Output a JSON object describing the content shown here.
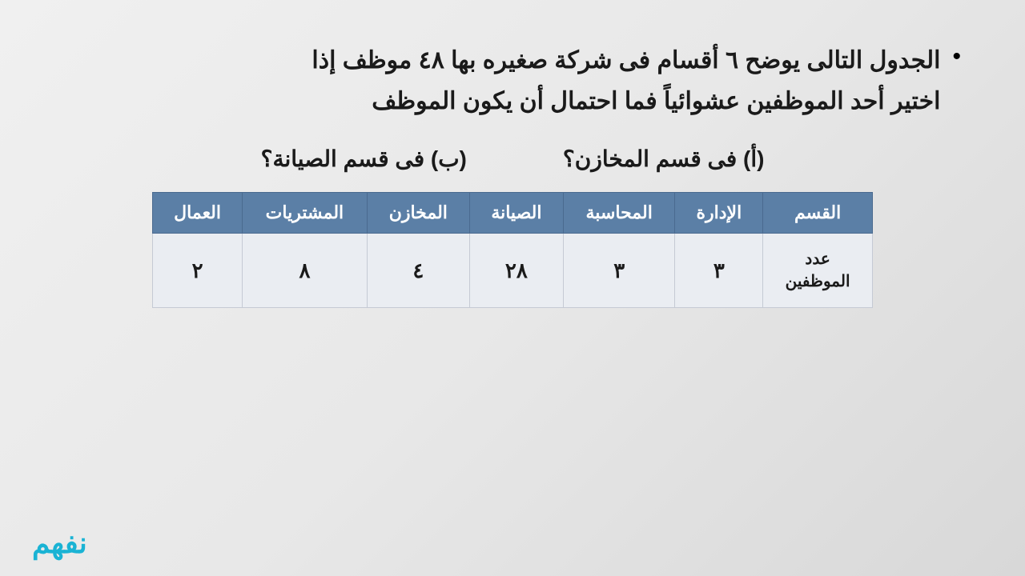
{
  "question": {
    "main_text_line1": "الجدول التالى يوضح ٦ أقسام فى شركة صغيره بها ٤٨ موظف إذا",
    "main_text_line2": "اختير أحد الموظفين عشوائياً فما احتمال أن يكون الموظف",
    "part_a": "(أ) فى قسم المخازن؟",
    "part_b": "(ب) فى قسم الصيانة؟"
  },
  "table": {
    "headers": [
      "القسم",
      "الإدارة",
      "المحاسبة",
      "الصيانة",
      "المخازن",
      "المشتريات",
      "العمال"
    ],
    "row_label": "عدد الموظفين",
    "values": [
      "٣",
      "٣",
      "٢٨",
      "٤",
      "٨",
      "٢"
    ]
  },
  "logo": {
    "text": "فهم"
  }
}
